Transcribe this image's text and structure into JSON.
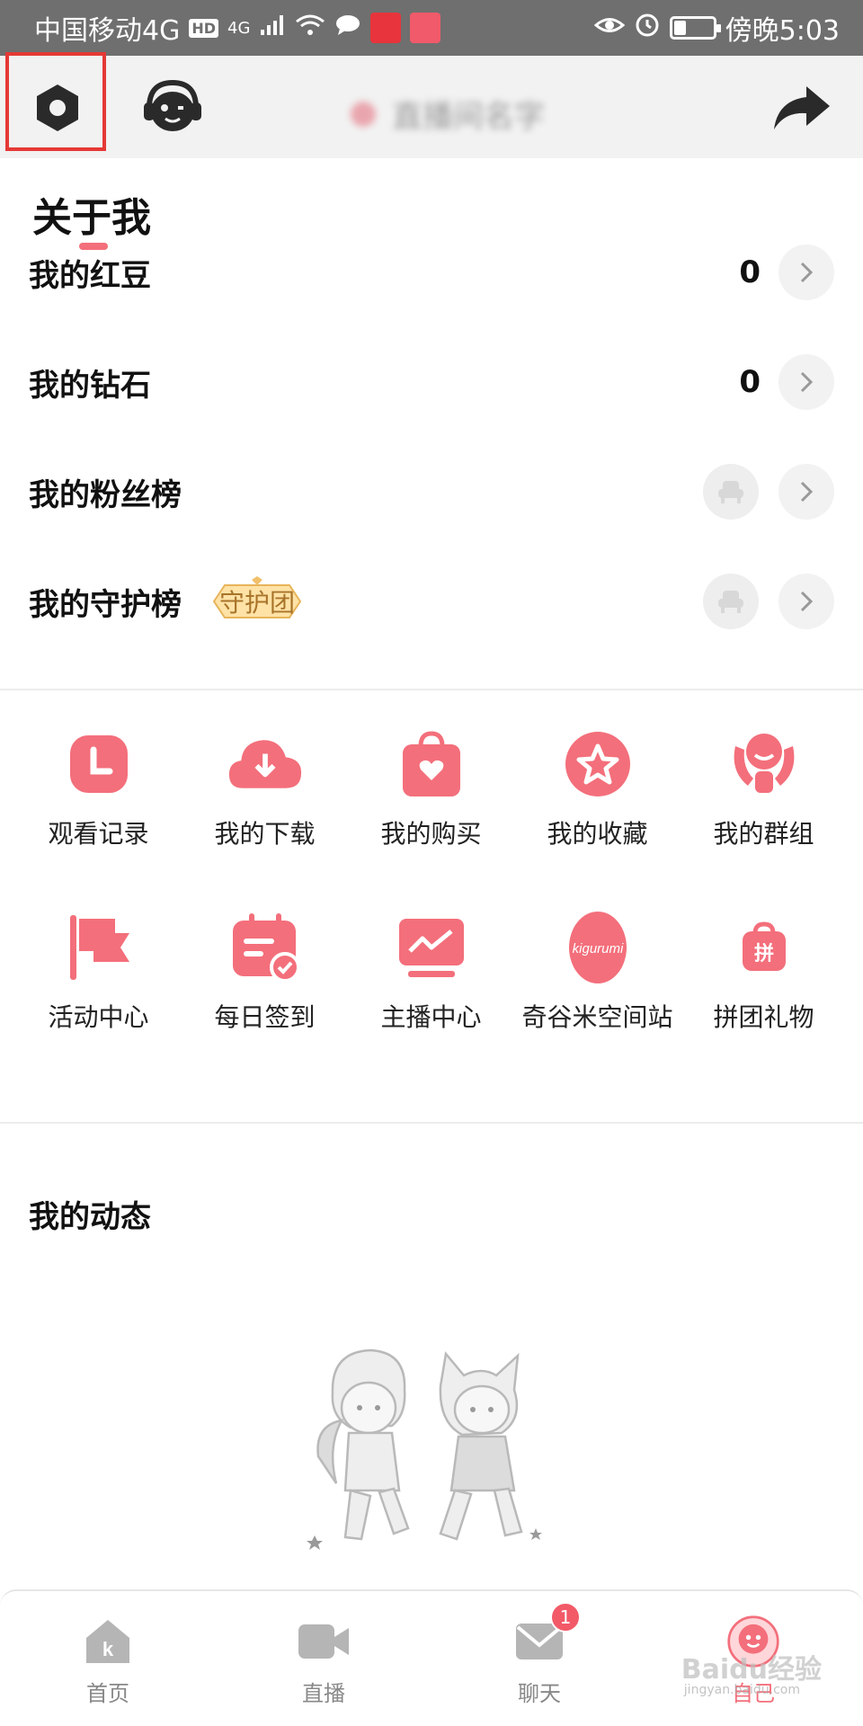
{
  "status_bar": {
    "carrier": "中国移动4G",
    "hd": "HD",
    "signal": "4G",
    "time": "傍晚5:03"
  },
  "header": {
    "blurred_title": "直播间名字"
  },
  "about": {
    "title": "关于我",
    "rows": [
      {
        "label": "我的红豆",
        "value": "0"
      },
      {
        "label": "我的钻石",
        "value": "0"
      },
      {
        "label": "我的粉丝榜"
      },
      {
        "label": "我的守护榜",
        "badge": "守护团"
      }
    ]
  },
  "grid": [
    {
      "label": "观看记录",
      "icon": "clock-icon"
    },
    {
      "label": "我的下载",
      "icon": "cloud-download-icon"
    },
    {
      "label": "我的购买",
      "icon": "shopping-bag-icon"
    },
    {
      "label": "我的收藏",
      "icon": "star-icon"
    },
    {
      "label": "我的群组",
      "icon": "group-icon"
    },
    {
      "label": "活动中心",
      "icon": "flag-icon"
    },
    {
      "label": "每日签到",
      "icon": "calendar-check-icon"
    },
    {
      "label": "主播中心",
      "icon": "monitor-chart-icon"
    },
    {
      "label": "奇谷米空间站",
      "icon": "kigurumi-icon",
      "icon_text": "kigurumi"
    },
    {
      "label": "拼团礼物",
      "icon": "group-gift-icon",
      "icon_text": "拼"
    }
  ],
  "dynamics": {
    "title": "我的动态"
  },
  "nav": {
    "items": [
      {
        "label": "首页",
        "icon": "home-icon",
        "icon_text": "k"
      },
      {
        "label": "直播",
        "icon": "video-camera-icon"
      },
      {
        "label": "聊天",
        "icon": "mail-icon",
        "badge": "1"
      },
      {
        "label": "自己",
        "icon": "profile-avatar-icon",
        "active": true
      }
    ]
  },
  "watermark": {
    "main": "Baidu经验",
    "sub": "jingyan.baidu.com"
  },
  "colors": {
    "accent": "#f36f7b",
    "status_bar": "#6f6f6f",
    "header_bg": "#f2f2f2",
    "highlight": "#e53935"
  }
}
